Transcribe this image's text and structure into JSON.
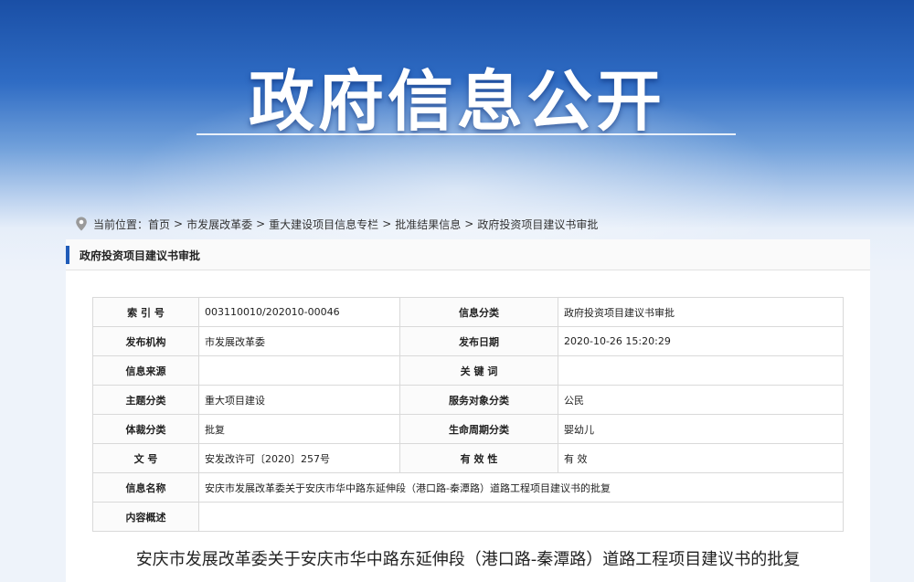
{
  "header": {
    "title": "政府信息公开"
  },
  "breadcrumb": {
    "prefix": "当前位置：",
    "items": [
      "首页",
      "市发展改革委",
      "重大建设项目信息专栏",
      "批准结果信息",
      "政府投资项目建议书审批"
    ],
    "separators": [
      " > ",
      " > ",
      "> ",
      "> "
    ]
  },
  "panel": {
    "title": "政府投资项目建议书审批"
  },
  "info_table": {
    "rows": [
      {
        "k1": "索 引 号",
        "v1": "003110010/202010-00046",
        "k2": "信息分类",
        "v2": "政府投资项目建议书审批"
      },
      {
        "k1": "发布机构",
        "v1": "市发展改革委",
        "k2": "发布日期",
        "v2": "2020-10-26 15:20:29"
      },
      {
        "k1": "信息来源",
        "v1": "",
        "k2": "关 键 词",
        "v2": ""
      },
      {
        "k1": "主题分类",
        "v1": "重大项目建设",
        "k2": "服务对象分类",
        "v2": "公民"
      },
      {
        "k1": "体裁分类",
        "v1": "批复",
        "k2": "生命周期分类",
        "v2": "婴幼儿"
      },
      {
        "k1": "文 号",
        "v1": "安发改许可〔2020〕257号",
        "k2": "有 效 性",
        "v2": "有 效"
      }
    ],
    "info_name_label": "信息名称",
    "info_name_value": "安庆市发展改革委关于安庆市华中路东延伸段（港口路-秦潭路）道路工程项目建议书的批复",
    "summary_label": "内容概述",
    "summary_value": ""
  },
  "document": {
    "title": "安庆市发展改革委关于安庆市华中路东延伸段（港口路-秦潭路）道路工程项目建议书的批复"
  },
  "colors": {
    "accent": "#1f5bb8",
    "hero_top": "#1a4fa6"
  },
  "icons": {
    "breadcrumb": "location-pin-icon"
  }
}
